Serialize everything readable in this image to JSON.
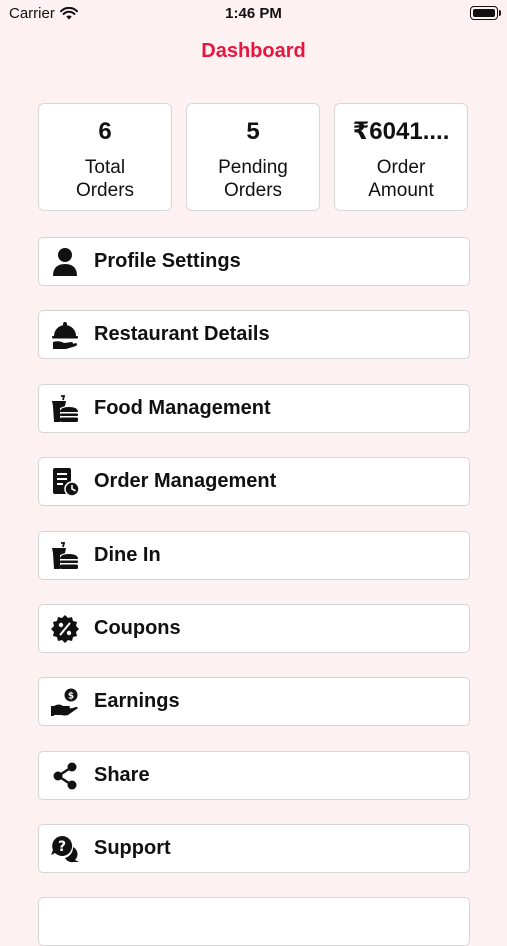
{
  "status_bar": {
    "carrier": "Carrier",
    "time": "1:46 PM"
  },
  "header": {
    "title": "Dashboard"
  },
  "stats": [
    {
      "value": "6",
      "label_line1": "Total",
      "label_line2": "Orders"
    },
    {
      "value": "5",
      "label_line1": "Pending",
      "label_line2": "Orders"
    },
    {
      "value": "₹6041....",
      "label_line1": "Order",
      "label_line2": "Amount"
    }
  ],
  "menu": {
    "items": [
      {
        "label": "Profile Settings",
        "icon": "person-icon"
      },
      {
        "label": "Restaurant Details",
        "icon": "cloche-icon"
      },
      {
        "label": "Food Management",
        "icon": "burger-drink-icon"
      },
      {
        "label": "Order Management",
        "icon": "order-clock-icon"
      },
      {
        "label": "Dine In",
        "icon": "burger-drink-icon"
      },
      {
        "label": "Coupons",
        "icon": "coupon-percent-icon"
      },
      {
        "label": "Earnings",
        "icon": "money-hand-icon"
      },
      {
        "label": "Share",
        "icon": "share-icon"
      },
      {
        "label": "Support",
        "icon": "support-chat-icon"
      }
    ]
  },
  "colors": {
    "accent": "#e8163f",
    "background": "#fdf1f2"
  }
}
